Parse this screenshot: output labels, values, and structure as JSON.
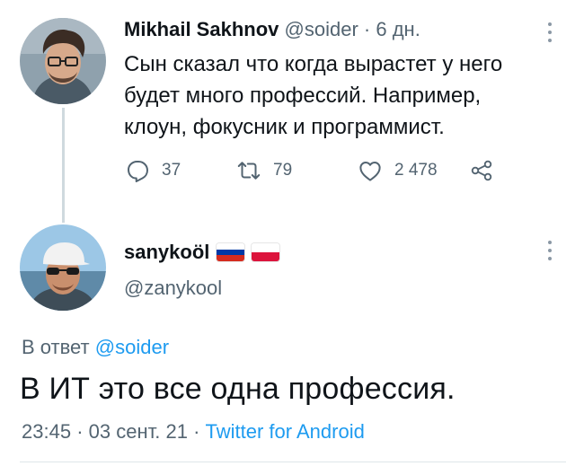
{
  "original_tweet": {
    "author_name": "Mikhail Sakhnov",
    "handle": "@soider",
    "separator": "·",
    "time_ago": "6 дн.",
    "text_lines": [
      "Сын сказал что когда вырастет у него",
      "будет много профессий. Например,",
      "клоун, фокусник и программист."
    ],
    "replies_count": "37",
    "retweets_count": "79",
    "likes_count": "2 478",
    "icons": [
      "reply-icon",
      "retweet-icon",
      "like-icon",
      "share-icon",
      "more-icon"
    ]
  },
  "reply_tweet": {
    "author_name": "sanykoöl",
    "flags": [
      "russia-flag",
      "poland-flag"
    ],
    "handle": "@zanykool",
    "reply_to_prefix": "В ответ",
    "reply_to_handle": "@soider",
    "text": "В ИТ это все одна профессия.",
    "time": "23:45",
    "date": "03 сент. 21",
    "separator": "·",
    "client": "Twitter for Android"
  },
  "colors": {
    "accent": "#1d9bf0",
    "text": "#0f1419",
    "muted": "#536471",
    "line": "#cfd9de",
    "flag_white": "#ffffff",
    "flag_blue": "#0039a6",
    "flag_red": "#d52b1e",
    "poland_red": "#dc143c"
  }
}
